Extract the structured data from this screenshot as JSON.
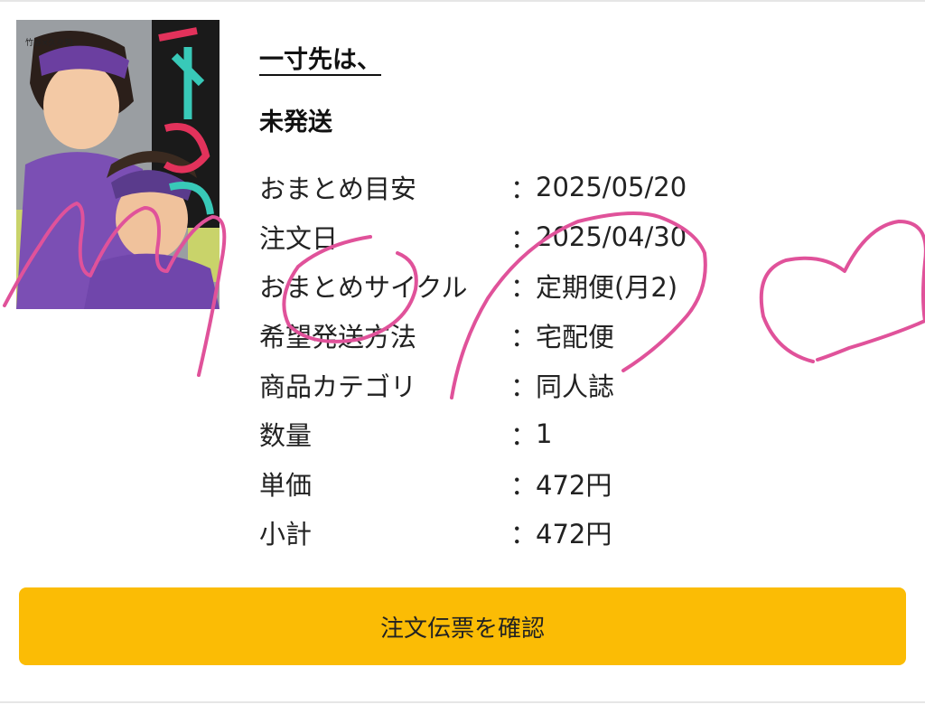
{
  "product": {
    "title": "一寸先は、",
    "status": "未発送",
    "cover_text": {
      "title_art": "一寸先は、",
      "small_caption": "竹谷×久々知"
    }
  },
  "details": [
    {
      "label": "おまとめ目安",
      "sep": "：",
      "value": "2025/05/20"
    },
    {
      "label": "注文日",
      "sep": "：",
      "value": "2025/04/30"
    },
    {
      "label": "おまとめサイクル",
      "sep": "：",
      "value": " 定期便(月2)"
    },
    {
      "label": "希望発送方法",
      "sep": "：",
      "value": "宅配便"
    },
    {
      "label": "商品カテゴリ",
      "sep": "：",
      "value": "同人誌"
    },
    {
      "label": "数量",
      "sep": "：",
      "value": "1"
    },
    {
      "label": "単価",
      "sep": "：",
      "value": "472円"
    },
    {
      "label": "小計",
      "sep": "：",
      "value": "472円"
    }
  ],
  "actions": {
    "confirm_label": "注文伝票を確認"
  },
  "colors": {
    "button": "#fbbc05",
    "scribble": "#e0529a"
  }
}
